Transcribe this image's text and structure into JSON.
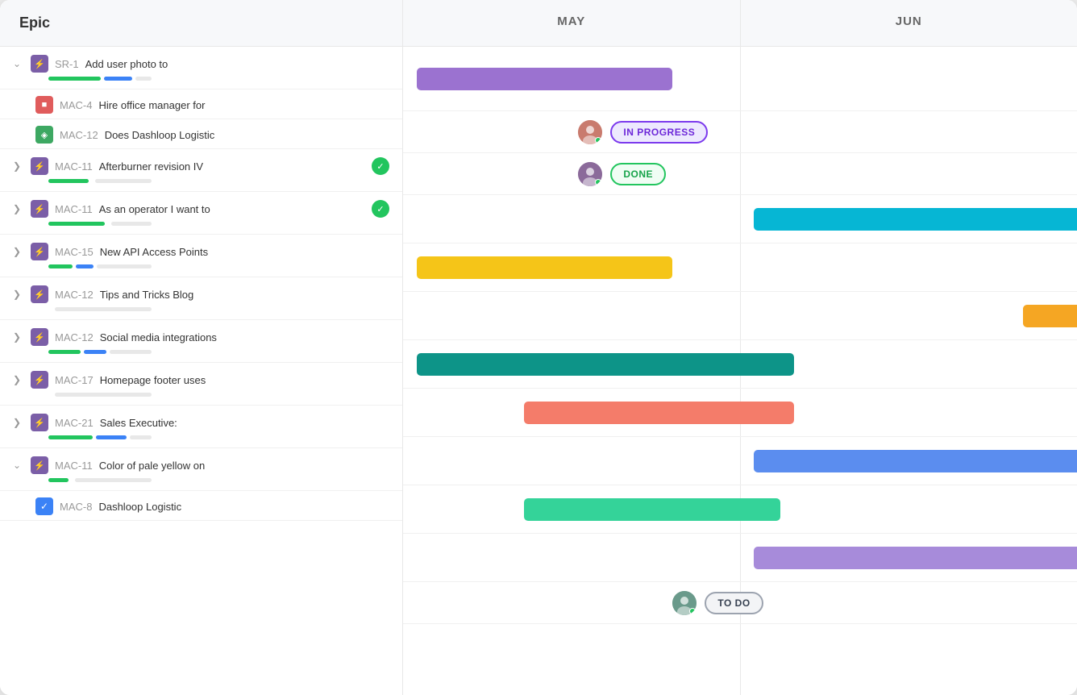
{
  "header": {
    "epic_label": "Epic",
    "months": [
      "MAY",
      "JUN"
    ]
  },
  "rows": [
    {
      "id": "sr1",
      "type": "parent",
      "expanded": true,
      "icon": "purple",
      "ticket": "SR-1",
      "title": "Add user photo to",
      "progress_green": 65,
      "progress_blue": 35,
      "gantt": {
        "bar_color": "purple",
        "left_pct": 2,
        "width_pct": 38
      }
    },
    {
      "id": "mac4",
      "type": "child",
      "icon": "red",
      "ticket": "MAC-4",
      "title": "Hire office manager for",
      "gantt": {
        "type": "avatar-status",
        "left_pct": 26,
        "status": "IN PROGRESS",
        "status_type": "in-progress"
      }
    },
    {
      "id": "mac12a",
      "type": "child",
      "icon": "green",
      "ticket": "MAC-12",
      "title": "Does Dashloop Logistic",
      "gantt": {
        "type": "avatar-status",
        "left_pct": 26,
        "status": "DONE",
        "status_type": "done"
      }
    },
    {
      "id": "mac11a",
      "type": "parent",
      "expanded": false,
      "icon": "purple",
      "ticket": "MAC-11",
      "title": "Afterburner revision IV",
      "has_check": true,
      "progress_green": 50,
      "progress_blue": 0,
      "gantt": {
        "bar_color": "cyan",
        "left_pct": 52,
        "width_pct": 48,
        "overflow": true
      }
    },
    {
      "id": "mac11b",
      "type": "parent",
      "expanded": false,
      "icon": "purple",
      "ticket": "MAC-11",
      "title": "As an operator I want to",
      "has_check": true,
      "progress_green": 70,
      "progress_blue": 0,
      "gantt": {
        "bar_color": "yellow",
        "left_pct": 2,
        "width_pct": 38
      }
    },
    {
      "id": "mac15",
      "type": "parent",
      "expanded": false,
      "icon": "purple",
      "ticket": "MAC-15",
      "title": "New API Access Points",
      "progress_green": 30,
      "progress_blue": 22,
      "gantt": {
        "bar_color": "orange",
        "left_pct": 92,
        "width_pct": 10,
        "overflow": true
      }
    },
    {
      "id": "mac12b",
      "type": "parent",
      "expanded": false,
      "icon": "purple",
      "ticket": "MAC-12",
      "title": "Tips and Tricks Blog",
      "progress_green": 0,
      "progress_blue": 0,
      "gantt": {
        "bar_color": "teal",
        "left_pct": 2,
        "width_pct": 56
      }
    },
    {
      "id": "mac12c",
      "type": "parent",
      "expanded": false,
      "icon": "purple",
      "ticket": "MAC-12",
      "title": "Social media integrations",
      "progress_green": 40,
      "progress_blue": 28,
      "gantt": {
        "bar_color": "salmon",
        "left_pct": 18,
        "width_pct": 40
      }
    },
    {
      "id": "mac17",
      "type": "parent",
      "expanded": false,
      "icon": "purple",
      "ticket": "MAC-17",
      "title": "Homepage footer uses",
      "progress_green": 0,
      "progress_blue": 0,
      "gantt": {
        "bar_color": "blue",
        "left_pct": 52,
        "width_pct": 48,
        "overflow": true
      }
    },
    {
      "id": "mac21",
      "type": "parent",
      "expanded": false,
      "icon": "purple",
      "ticket": "MAC-21",
      "title": "Sales Executive:",
      "progress_green": 55,
      "progress_blue": 38,
      "gantt": {
        "bar_color": "green",
        "left_pct": 18,
        "width_pct": 38
      }
    },
    {
      "id": "mac11c",
      "type": "parent",
      "expanded": true,
      "icon": "purple",
      "ticket": "MAC-11",
      "title": "Color of pale yellow on",
      "progress_green": 25,
      "progress_blue": 0,
      "gantt": {
        "bar_color": "purple2",
        "left_pct": 52,
        "width_pct": 48,
        "overflow": true
      }
    },
    {
      "id": "mac8",
      "type": "child",
      "icon": "blue-check",
      "ticket": "MAC-8",
      "title": "Dashloop Logistic",
      "gantt": {
        "type": "avatar-status",
        "left_pct": 40,
        "status": "TO DO",
        "status_type": "todo"
      }
    }
  ]
}
